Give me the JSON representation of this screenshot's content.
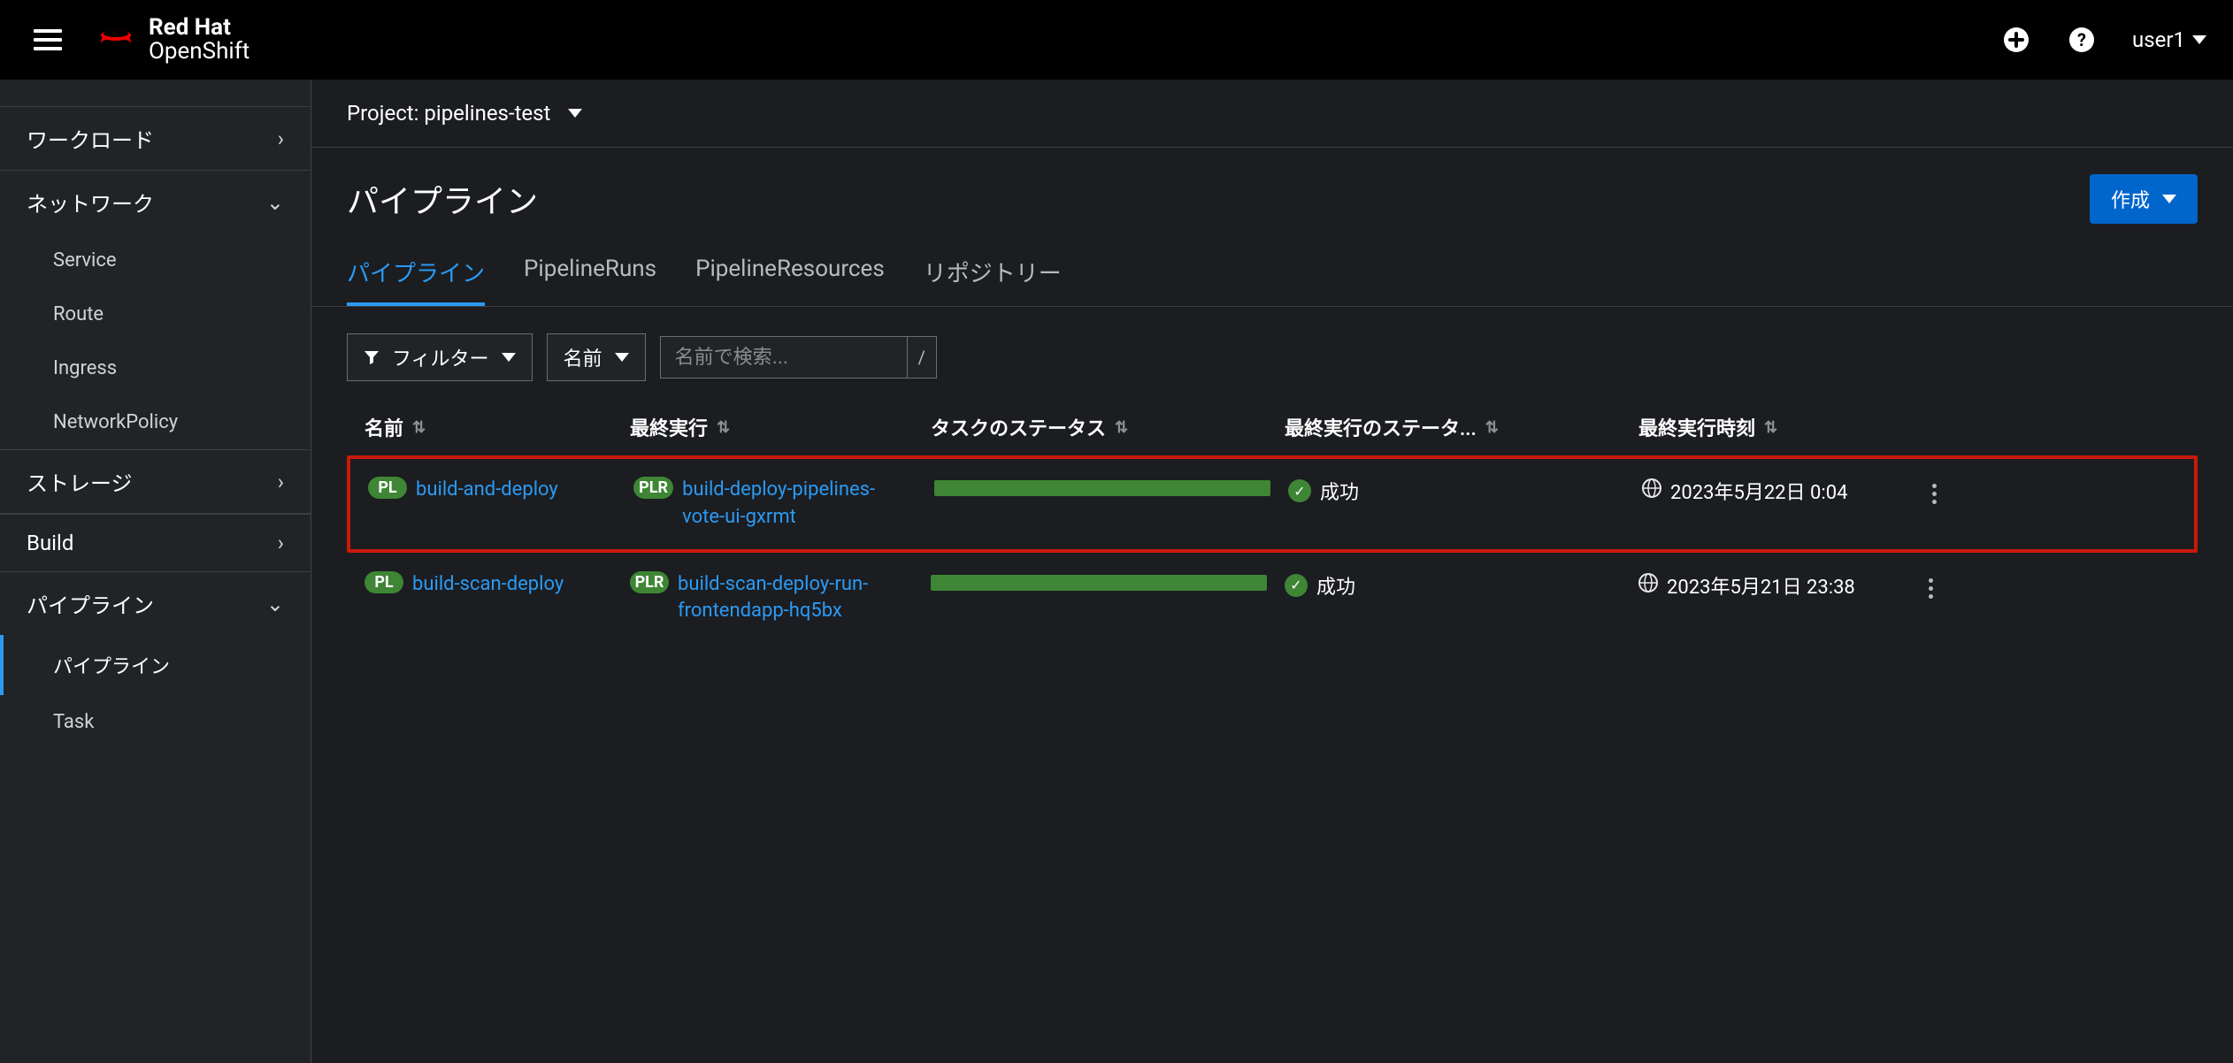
{
  "brand": {
    "line1": "Red Hat",
    "line2": "OpenShift"
  },
  "user": "user1",
  "sidebar": {
    "workloads": "ワークロード",
    "network": "ネットワーク",
    "network_items": [
      "Service",
      "Route",
      "Ingress",
      "NetworkPolicy"
    ],
    "storage": "ストレージ",
    "build": "Build",
    "pipeline": "パイプライン",
    "pipeline_items": [
      "パイプライン",
      "Task"
    ]
  },
  "project": {
    "label": "Project:",
    "value": "pipelines-test"
  },
  "page": {
    "title": "パイプライン",
    "create": "作成"
  },
  "tabs": [
    "パイプライン",
    "PipelineRuns",
    "PipelineResources",
    "リポジトリー"
  ],
  "toolbar": {
    "filter": "フィルター",
    "name": "名前",
    "search_placeholder": "名前で検索...",
    "shortcut": "/"
  },
  "columns": {
    "name": "名前",
    "last_run": "最終実行",
    "task_status": "タスクのステータス",
    "last_run_status": "最終実行のステータ...",
    "last_run_time": "最終実行時刻"
  },
  "badges": {
    "pl": "PL",
    "plr": "PLR"
  },
  "status_success": "成功",
  "rows": [
    {
      "name": "build-and-deploy",
      "run": "build-deploy-pipelines-vote-ui-gxrmt",
      "status": "成功",
      "time": "2023年5月22日 0:04",
      "highlighted": true
    },
    {
      "name": "build-scan-deploy",
      "run": "build-scan-deploy-run-frontendapp-hq5bx",
      "status": "成功",
      "time": "2023年5月21日 23:38",
      "highlighted": false
    }
  ]
}
